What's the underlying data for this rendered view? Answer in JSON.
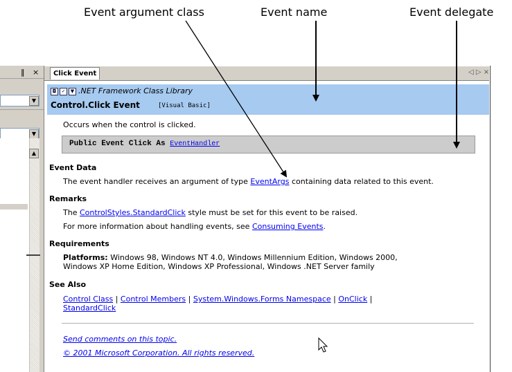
{
  "callouts": {
    "arg_class": "Event argument class",
    "event_name": "Event name",
    "delegate": "Event delegate"
  },
  "left_panel": {
    "pin_glyph": "‖",
    "close_glyph": "×"
  },
  "tab": {
    "label": "Click Event",
    "nav_glyphs": "◁ ▷ ×"
  },
  "header": {
    "library": ".NET Framework Class Library",
    "title": "Control.Click Event",
    "language": "[Visual Basic]"
  },
  "content": {
    "summary": "Occurs when the control is clicked.",
    "syntax_prefix": "Public Event Click As ",
    "syntax_type": "EventHandler",
    "event_data_heading": "Event Data",
    "event_data_pre": "The event handler receives an argument of type ",
    "event_data_link": "EventArgs",
    "event_data_post": " containing data related to this event.",
    "remarks_heading": "Remarks",
    "remarks_1_pre": "The ",
    "remarks_1_link": "ControlStyles.StandardClick",
    "remarks_1_post": " style must be set for this event to be raised.",
    "remarks_2_pre": "For more information about handling events, see ",
    "remarks_2_link": "Consuming Events",
    "remarks_2_post": ".",
    "requirements_heading": "Requirements",
    "platforms_label": "Platforms:",
    "platforms_line1": " Windows 98, Windows NT 4.0, Windows Millennium Edition, Windows 2000,",
    "platforms_line2": "Windows XP Home Edition, Windows XP Professional, Windows .NET Server family",
    "see_also_heading": "See Also",
    "see_also_links": [
      "Control Class",
      "Control Members",
      "System.Windows.Forms Namespace",
      "OnClick",
      "StandardClick"
    ],
    "separator": " | ",
    "feedback": "Send comments on this topic.",
    "copyright": "© 2001 Microsoft Corporation. All rights reserved."
  }
}
